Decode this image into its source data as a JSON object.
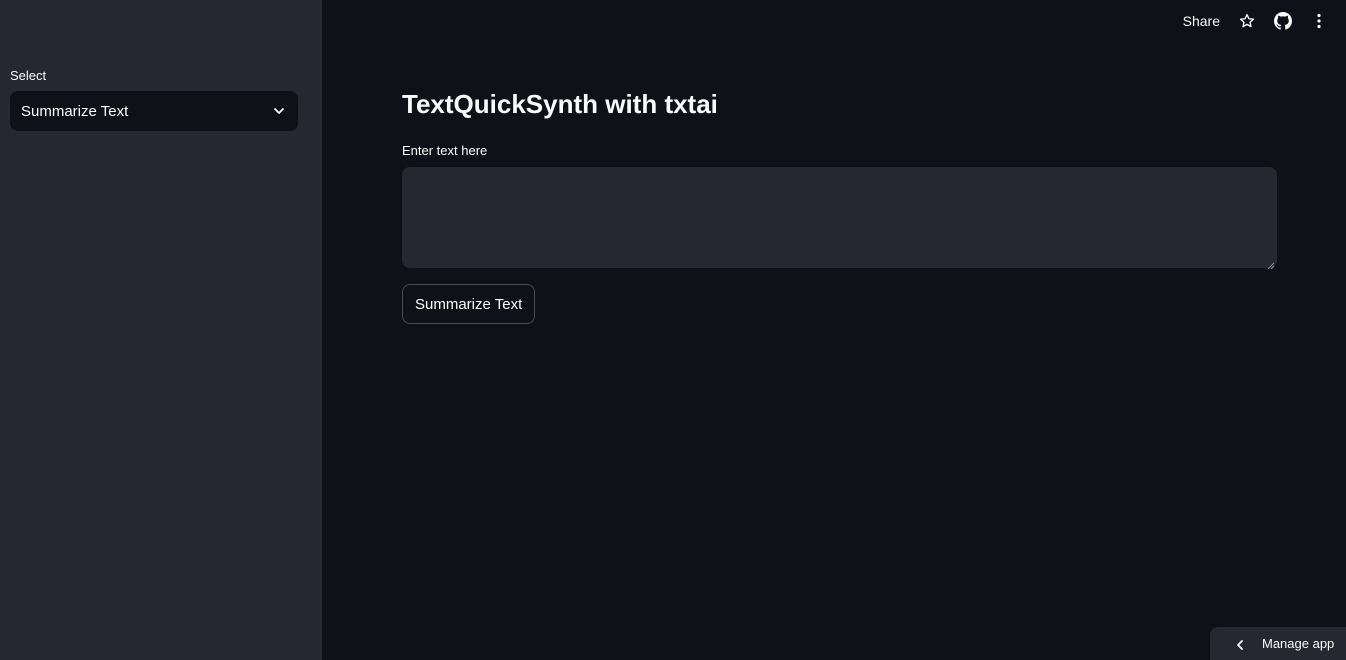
{
  "sidebar": {
    "select_label": "Select",
    "select_value": "Summarize Text",
    "select_icon": "chevron-down-icon"
  },
  "toolbar": {
    "share_label": "Share",
    "icons": [
      "star-icon",
      "github-icon",
      "kebab-menu-icon"
    ]
  },
  "main": {
    "title": "TextQuickSynth with txtai",
    "input_label": "Enter text here",
    "input_value": "",
    "button_label": "Summarize Text"
  },
  "footer": {
    "manage_label": "Manage app"
  },
  "colors": {
    "background": "#0e1117",
    "sidebar": "#262730",
    "text": "#fafafa"
  }
}
